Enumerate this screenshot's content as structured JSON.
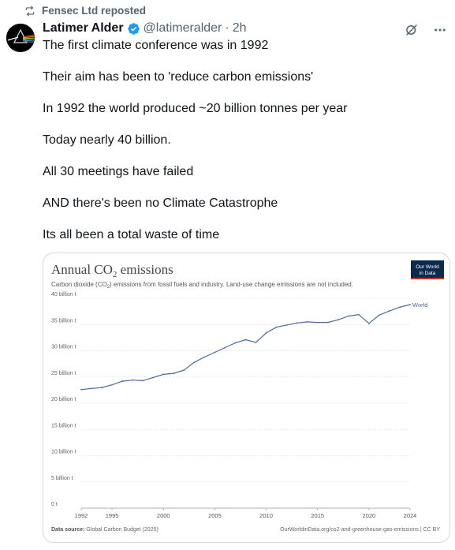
{
  "repost": {
    "label": "Fensec Ltd reposted",
    "icon": "repost-icon"
  },
  "author": {
    "display_name": "Latimer Alder",
    "handle": "@latimeralder",
    "separator": "·",
    "time": "2h",
    "verified": true
  },
  "tweet": {
    "paragraphs": [
      "The first climate conference was in 1992",
      "Their aim has been to 'reduce carbon emissions'",
      "In 1992 the world produced ~20 billion tonnes per year",
      "Today nearly 40 billion.",
      "All 30 meetings have failed",
      "AND there's been no Climate Catastrophe",
      "Its all been a total waste of time"
    ]
  },
  "colors": {
    "accent": "#1d9bf0",
    "muted": "#536471",
    "series": "#4c6a9c",
    "owid_badge": "#0c2a4e",
    "owid_red": "#c0392b"
  },
  "chart_data": {
    "type": "line",
    "title_main": "Annual CO",
    "title_sub2": "2",
    "title_rest": " emissions",
    "subtitle_a": "Carbon dioxide (CO",
    "subtitle_sub": "2",
    "subtitle_b": ") emissions from fossil fuels and industry. Land-use change emissions are not included.",
    "badge_line1": "Our World",
    "badge_line2": "in Data",
    "y_ticks": [
      "0 t",
      "5 billion t",
      "10 billion t",
      "15 billion t",
      "20 billion t",
      "25 billion t",
      "30 billion t",
      "35 billion t",
      "40 billion t"
    ],
    "y_tick_values": [
      0,
      5,
      10,
      15,
      20,
      25,
      30,
      35,
      40
    ],
    "x_ticks": [
      "1992",
      "1995",
      "2000",
      "2005",
      "2010",
      "2015",
      "2020",
      "2024"
    ],
    "x_tick_values": [
      1992,
      1995,
      2000,
      2005,
      2010,
      2015,
      2020,
      2024
    ],
    "xlim": [
      1992,
      2024
    ],
    "ylim": [
      0,
      40
    ],
    "grid": true,
    "series": [
      {
        "name": "World",
        "x": [
          1992,
          1993,
          1994,
          1995,
          1996,
          1997,
          1998,
          1999,
          2000,
          2001,
          2002,
          2003,
          2004,
          2005,
          2006,
          2007,
          2008,
          2009,
          2010,
          2011,
          2012,
          2013,
          2014,
          2015,
          2016,
          2017,
          2018,
          2019,
          2020,
          2021,
          2022,
          2023,
          2024
        ],
        "values": [
          22.6,
          22.8,
          23.0,
          23.5,
          24.2,
          24.4,
          24.3,
          24.9,
          25.5,
          25.7,
          26.3,
          27.8,
          28.8,
          29.7,
          30.6,
          31.5,
          32.1,
          31.6,
          33.4,
          34.5,
          34.9,
          35.3,
          35.5,
          35.4,
          35.4,
          35.9,
          36.6,
          36.9,
          35.2,
          36.8,
          37.6,
          38.3,
          38.8
        ]
      }
    ],
    "source_label": "Data source:",
    "source_text": "Global Carbon Budget (2025)",
    "url_text": "OurWorldinData.org/co2-and-greenhouse-gas-emissions | CC BY"
  }
}
